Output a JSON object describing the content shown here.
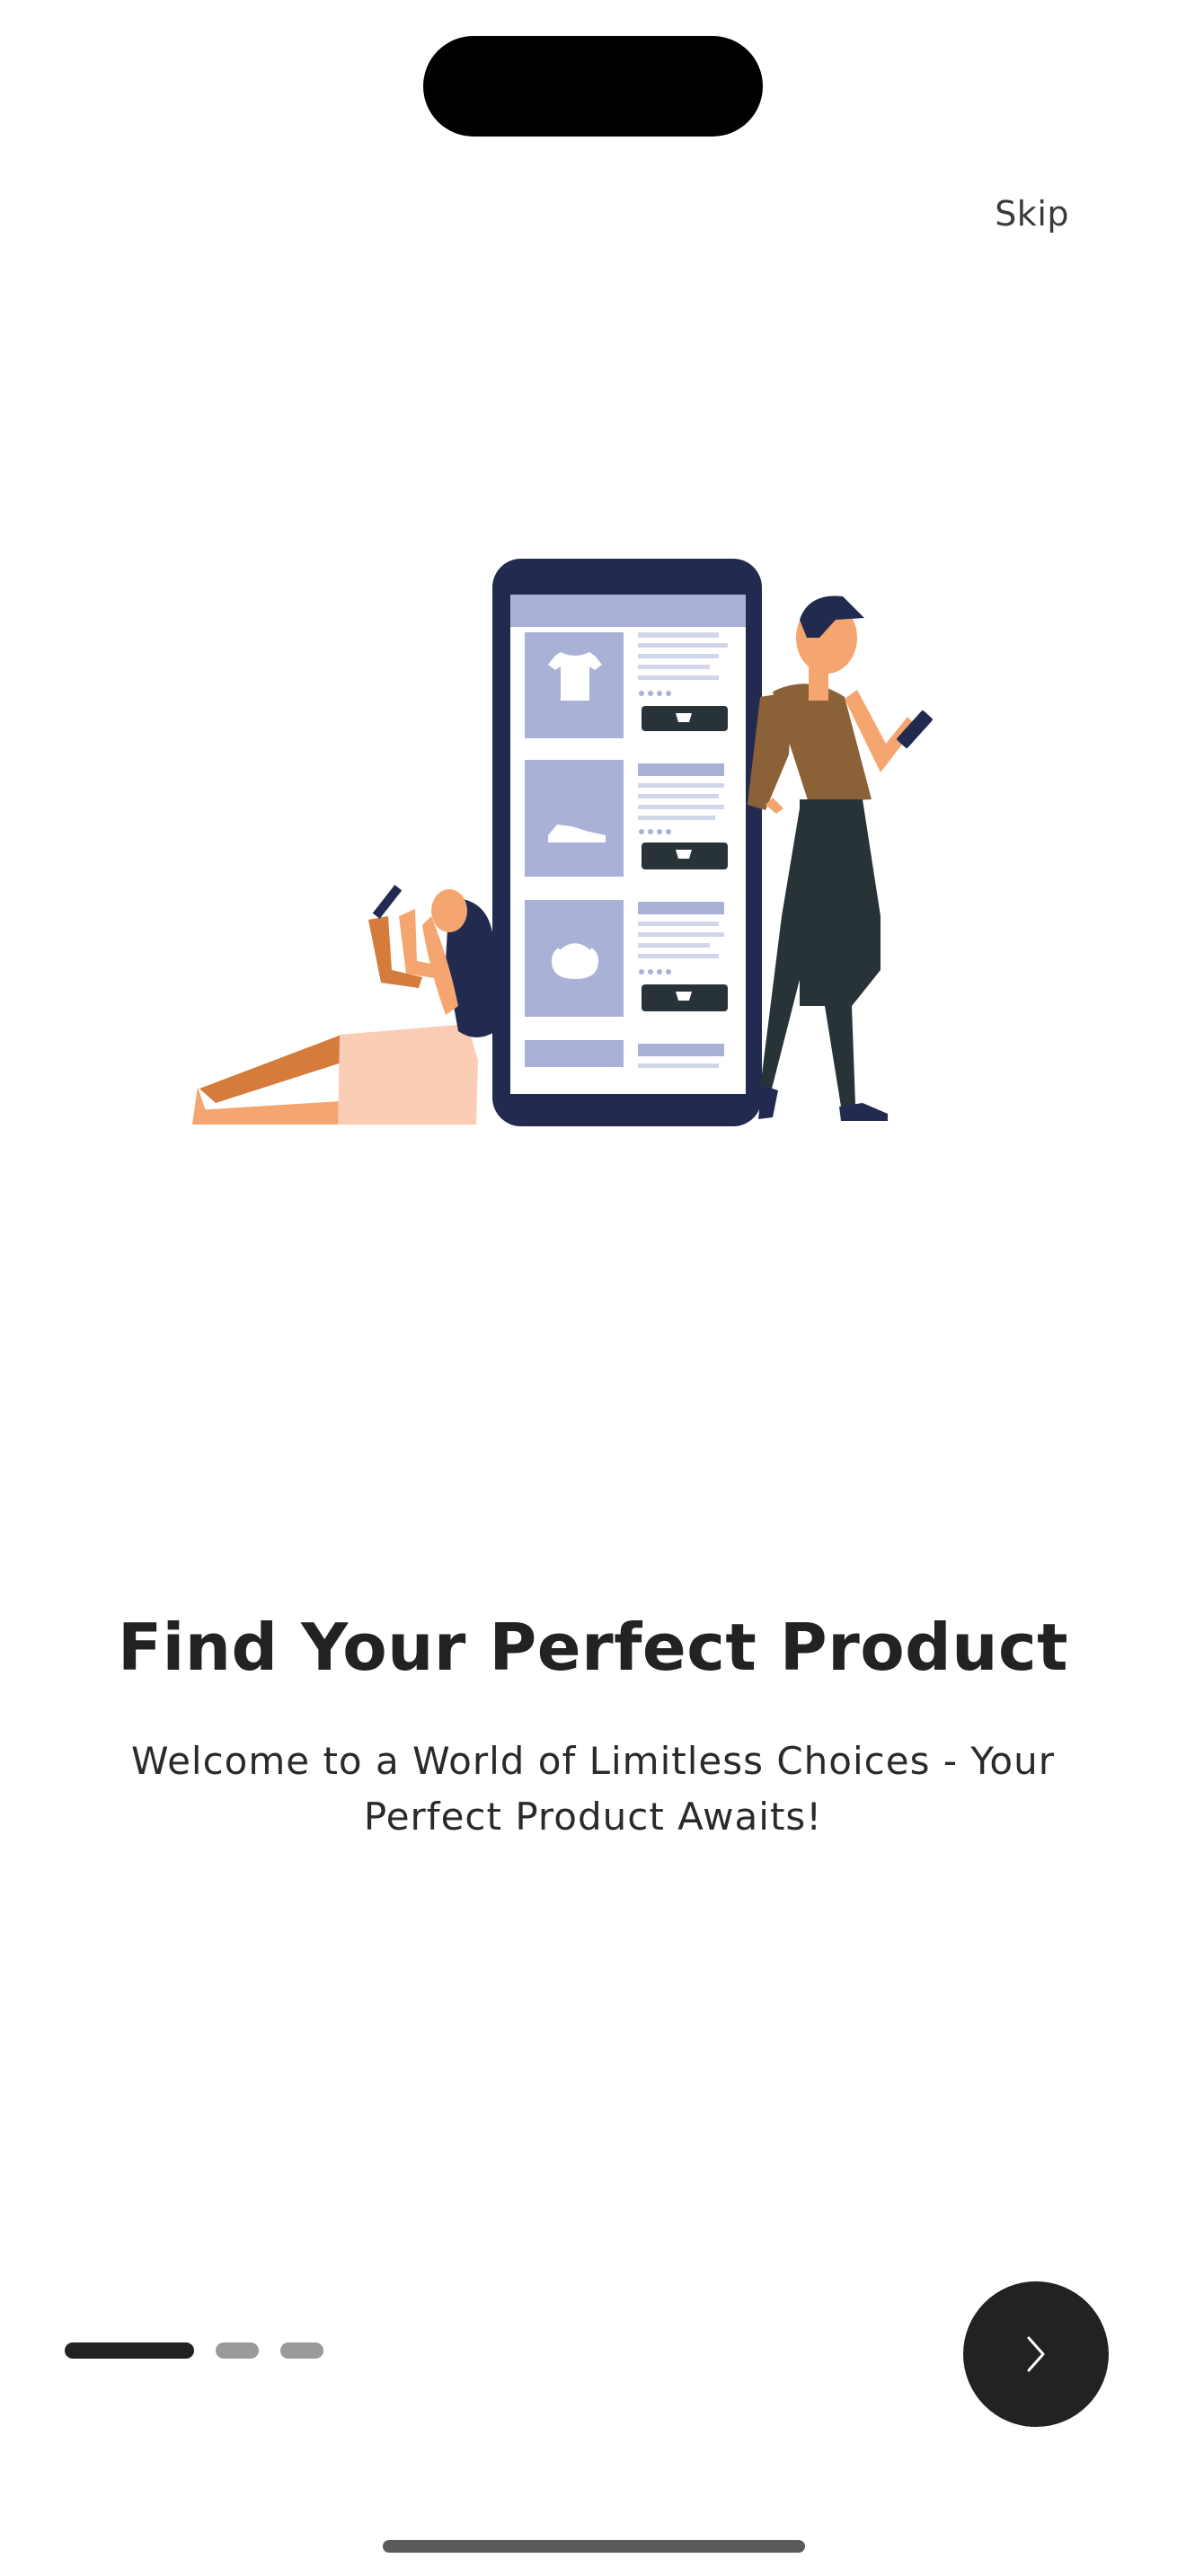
{
  "onboarding": {
    "skip_label": "Skip",
    "title": "Find Your Perfect Product",
    "subtitle": "Welcome to a World of Limitless Choices - Your Perfect Product Awaits!",
    "next_icon": "chevron-right-icon",
    "pagination": {
      "total_pages": 3,
      "current_page": 1
    }
  },
  "colors": {
    "primary_dark": "#222222",
    "inactive_dot": "#9a9a9a",
    "phone_frame": "#222b4f",
    "phone_accent": "#a9b2d6",
    "skin": "#f5a56f",
    "man_shirt": "#8b6238",
    "man_pants": "#283338",
    "woman_dress": "#fbcdb5",
    "woman_hair": "#222b4f"
  }
}
